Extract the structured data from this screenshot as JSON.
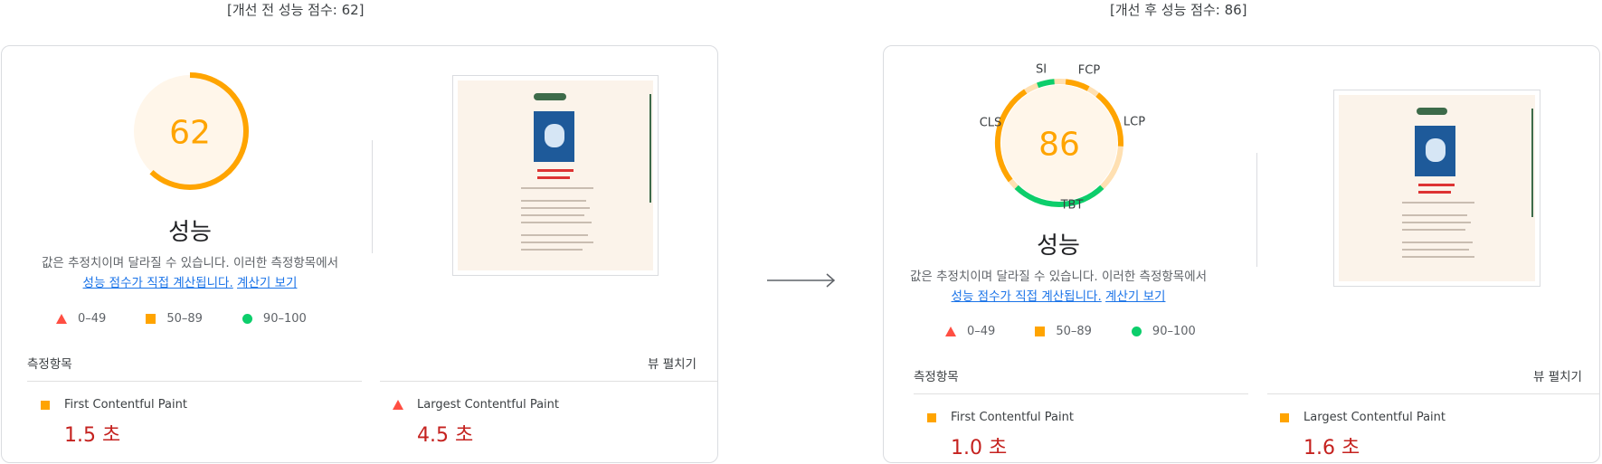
{
  "colors": {
    "orange": "#ffa400",
    "green": "#0cce6b",
    "red": "#ff4e42",
    "link": "#1a73e8",
    "value_red": "#c5221f"
  },
  "before": {
    "caption": "[개선 전 성능 점수: 62]",
    "score": "62",
    "score_fraction": 0.62,
    "title": "성능",
    "desc_line1": "값은 추정치이며 달라질 수 있습니다. 이러한 측정항목에서",
    "link1": "성능 점수가 직접 계산됩니다.",
    "link2": "계산기 보기",
    "legend": [
      "0–49",
      "50–89",
      "90–100"
    ],
    "metrics_header": "측정항목",
    "expand_label": "뷰 펼치기",
    "metric1": {
      "name": "First Contentful Paint",
      "value": "1.5 초",
      "icon": "orange-square-icon"
    },
    "metric2": {
      "name": "Largest Contentful Paint",
      "value": "4.5 초",
      "icon": "red-triangle-icon"
    }
  },
  "after": {
    "caption": "[개선 후 성능 점수: 86]",
    "score": "86",
    "score_fraction": 0.86,
    "gauge_labels": [
      "SI",
      "FCP",
      "LCP",
      "TBT",
      "CLS"
    ],
    "title": "성능",
    "desc_line1": "값은 추정치이며 달라질 수 있습니다. 이러한 측정항목에서",
    "link1": "성능 점수가 직접 계산됩니다.",
    "link2": "계산기 보기",
    "legend": [
      "0–49",
      "50–89",
      "90–100"
    ],
    "metrics_header": "측정항목",
    "expand_label": "뷰 펼치기",
    "metric1": {
      "name": "First Contentful Paint",
      "value": "1.0 초",
      "icon": "orange-square-icon"
    },
    "metric2": {
      "name": "Largest Contentful Paint",
      "value": "1.6 초",
      "icon": "orange-square-icon"
    }
  }
}
